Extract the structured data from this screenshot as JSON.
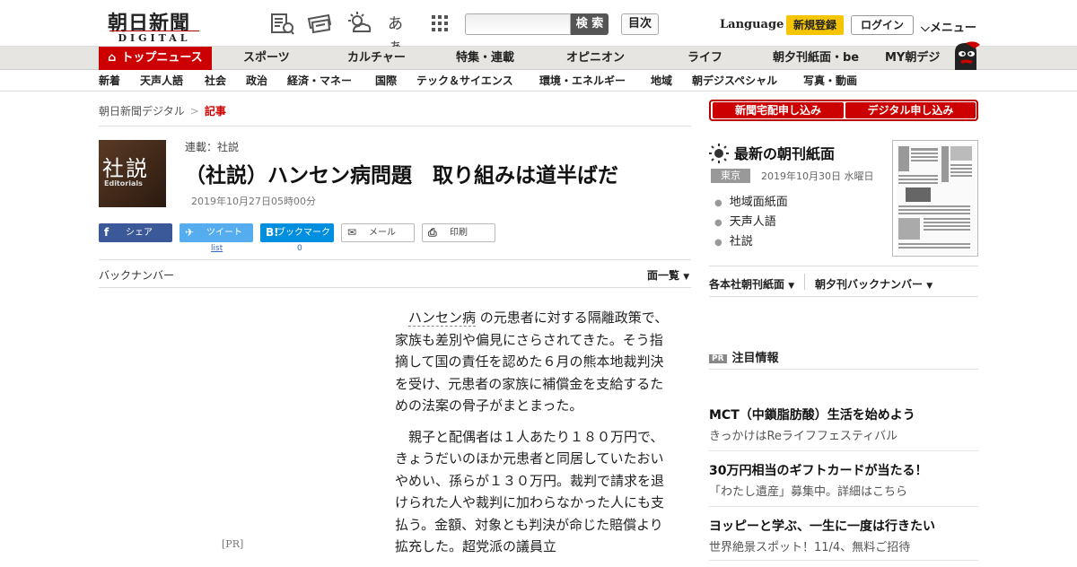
{
  "header": {
    "logo_text": "朝日新聞",
    "logo_sub": "DIGITAL",
    "font_size_label": "あぁ",
    "search_placeholder": "",
    "search_button": "検 索",
    "toc_button": "目次",
    "language": "Language",
    "register": "新規登録",
    "login": "ログイン",
    "menu": "メニュー"
  },
  "nav": {
    "items": [
      "トップニュース",
      "スポーツ",
      "カルチャー",
      "特集・連載",
      "オピニオン",
      "ライフ",
      "朝夕刊紙面・be",
      "MY朝デジ"
    ]
  },
  "subnav": {
    "items": [
      "新着",
      "天声人語",
      "社会",
      "政治",
      "経済・マネー",
      "国際",
      "テック＆サイエンス",
      "環境・エネルギー",
      "地域",
      "朝デジスペシャル",
      "写真・動画"
    ]
  },
  "breadcrumb": {
    "home": "朝日新聞デジタル",
    "separator": ">",
    "current": "記事"
  },
  "article": {
    "logo_kanji": "社説",
    "logo_en": "Editorials",
    "series": "連載：社説",
    "title": "（社説）ハンセン病問題　取り組みは道半ばだ",
    "date": "2019年10月27日05時00分",
    "share": {
      "facebook": "シェア",
      "twitter": "ツイート",
      "hatena": "ブックマーク",
      "mail": "メール",
      "print": "印刷",
      "twitter_count": "list",
      "hatena_count": "0"
    },
    "backnumber": "バックナンバー",
    "page_list": "面一覧",
    "pr_label": "[PR]",
    "body_term": "ハンセン病",
    "body_p1_rest": "の元患者に対する隔離政策で、家族も差別や偏見にさらされてきた。そう指摘して国の責任を認めた６月の熊本地裁判決を受け、元患者の家族に補償金を支給するための法案の骨子がまとまった。",
    "body_p2": "親子と配偶者は１人あたり１８０万円で、きょうだいのほか元患者と同居していたおいやめい、孫らが１３０万円。裁判で請求を退けられた人や裁判に加わらなかった人にも支払う。金額、対象とも判決が命じた賠償より拡充した。超党派の議員立"
  },
  "sidebar": {
    "btn_delivery": "新聞宅配申し込み",
    "btn_digital": "デジタル申し込み",
    "paper_title": "最新の朝刊紙面",
    "region": "東京",
    "paper_date": "2019年10月30日 水曜日",
    "paper_links": [
      "地域面紙面",
      "天声人語",
      "社説"
    ],
    "dd_honsha": "各本社朝刊紙面",
    "dd_back": "朝夕刊バックナンバー",
    "pr_badge": "PR",
    "pr_header": "注目情報",
    "pr_items": [
      {
        "title": "MCT（中鎖脂肪酸）生活を始めよう",
        "sub": "きっかけはReライフフェスティバル"
      },
      {
        "title": "30万円相当のギフトカードが当たる！",
        "sub": "「わたし遺産」募集中。詳細はこちら"
      },
      {
        "title": "ヨッピーと学ぶ、一生に一度は行きたい",
        "sub": "世界絶景スポット！11/4、無料ご招待"
      }
    ]
  },
  "colors": {
    "brand_red": "#cc0000",
    "register_yellow": "#f4c500",
    "nav_bg": "#e6e5e1"
  }
}
